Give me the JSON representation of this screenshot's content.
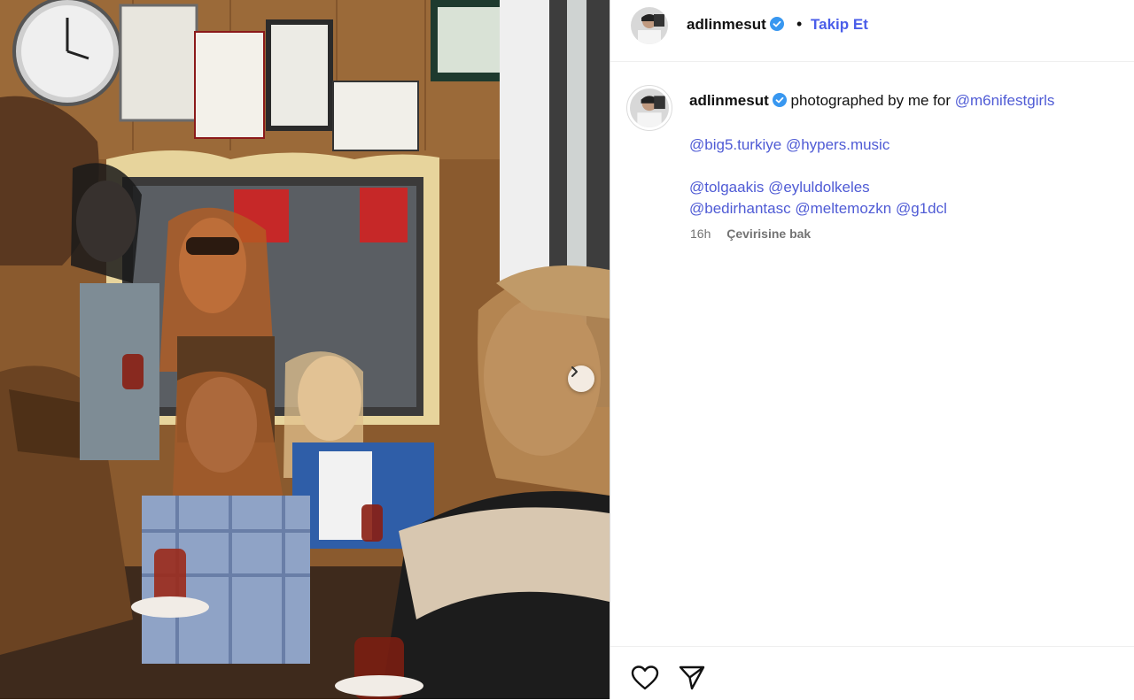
{
  "post": {
    "username": "adlinmesut",
    "separator": "•",
    "follow_label": "Takip Et",
    "caption": {
      "username": "adlinmesut",
      "text": "photographed by me for",
      "first_mention": "@m6nifestgirls",
      "line2": [
        "@big5.turkiye",
        "@hypers.music"
      ],
      "line3": [
        "@tolgaakis",
        "@eyluldolkeles"
      ],
      "line4": [
        "@bedirhantasc",
        "@meltemozkn",
        "@g1dcl"
      ]
    },
    "time_ago": "16h",
    "translate_label": "Çevirisine bak"
  },
  "colors": {
    "link": "#4f5bd5",
    "follow": "#4a5de9",
    "verified": "#3897f0",
    "meta": "#737373"
  },
  "icons": {
    "like": "heart-icon",
    "share": "paper-plane-icon",
    "next": "chevron-right-icon",
    "verified": "verified-badge-icon"
  }
}
